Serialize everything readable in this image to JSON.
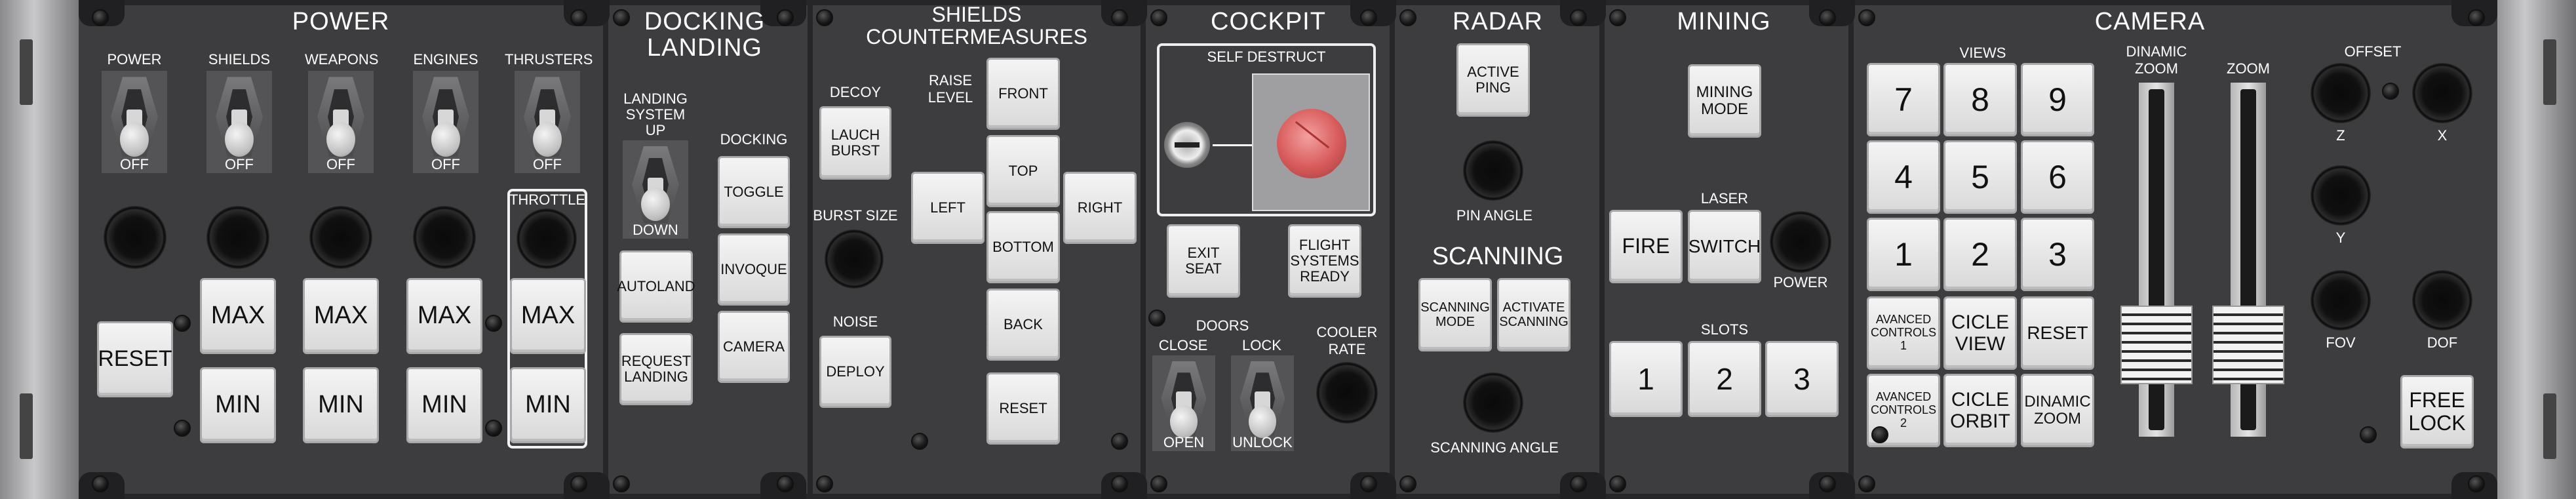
{
  "power": {
    "title": "POWER",
    "switches": [
      {
        "label": "POWER",
        "state": "OFF"
      },
      {
        "label": "SHIELDS",
        "state": "OFF"
      },
      {
        "label": "WEAPONS",
        "state": "OFF"
      },
      {
        "label": "ENGINES",
        "state": "OFF"
      },
      {
        "label": "THRUSTERS",
        "state": "OFF"
      }
    ],
    "reset": "RESET",
    "max": "MAX",
    "min": "MIN",
    "throttle": "THROTTLE"
  },
  "docking": {
    "title1": "DOCKING",
    "title2": "LANDING",
    "landing_system": [
      "LANDING",
      "SYSTEM",
      "UP"
    ],
    "landing_down": "DOWN",
    "autoland": "AUTOLAND",
    "request_landing": [
      "REQUEST",
      "LANDING"
    ],
    "docking_label": "DOCKING",
    "toggle": "TOGGLE",
    "invoque": "INVOQUE",
    "camera": "CAMERA"
  },
  "shields": {
    "title1": "SHIELDS",
    "title2": "COUNTERMEASURES",
    "decoy": "DECOY",
    "launch_burst": [
      "LAUCH",
      "BURST"
    ],
    "burst_size": "BURST  SIZE",
    "noise": "NOISE",
    "deploy": "DEPLOY",
    "raise_level": [
      "RAISE",
      "LEVEL"
    ],
    "front": "FRONT",
    "top": "TOP",
    "left": "LEFT",
    "right": "RIGHT",
    "bottom": "BOTTOM",
    "back": "BACK",
    "reset": "RESET"
  },
  "cockpit": {
    "title": "COCKPIT",
    "self_destruct": "SELF  DESTRUCT",
    "exit_seat": [
      "EXIT",
      "SEAT"
    ],
    "flight_systems": [
      "FLIGHT",
      "SYSTEMS",
      "READY"
    ],
    "doors": "DOORS",
    "close": "CLOSE",
    "open": "OPEN",
    "lock": "LOCK",
    "unlock": "UNLOCK",
    "cooler_rate": [
      "COOLER",
      "RATE"
    ]
  },
  "radar": {
    "title": "RADAR",
    "active_ping": [
      "ACTIVE",
      "PING"
    ],
    "pin_angle": "PIN  ANGLE",
    "scanning_title": "SCANNING",
    "scanning_mode": [
      "SCANNING",
      "MODE"
    ],
    "activate_scanning": [
      "ACTIVATE",
      "SCANNING"
    ],
    "scanning_angle": "SCANNING  ANGLE"
  },
  "mining": {
    "title": "MINING",
    "mining_mode": [
      "MINING",
      "MODE"
    ],
    "laser": "LASER",
    "fire": "FIRE",
    "switch": "SWITCH",
    "power": "POWER",
    "slots": "SLOTS",
    "slot_buttons": [
      "1",
      "2",
      "3"
    ]
  },
  "camera": {
    "title": "CAMERA",
    "views": "VIEWS",
    "keypad": [
      "7",
      "8",
      "9",
      "4",
      "5",
      "6",
      "1",
      "2",
      "3"
    ],
    "advanced1": [
      "AVANCED",
      "CONTROLS",
      "1"
    ],
    "cicle_view": [
      "CICLE",
      "VIEW"
    ],
    "reset": "RESET",
    "advanced2": [
      "AVANCED",
      "CONTROLS",
      "2"
    ],
    "cicle_orbit": [
      "CICLE",
      "ORBIT"
    ],
    "dinamic_zoom_btn": [
      "DINAMIC",
      "ZOOM"
    ],
    "dinamic_zoom": [
      "DINAMIC",
      "ZOOM"
    ],
    "zoom": "ZOOM",
    "offset": "OFFSET",
    "z": "Z",
    "x": "X",
    "y": "Y",
    "fov": "FOV",
    "dof": "DOF",
    "free_lock": [
      "FREE",
      "LOCK"
    ]
  }
}
